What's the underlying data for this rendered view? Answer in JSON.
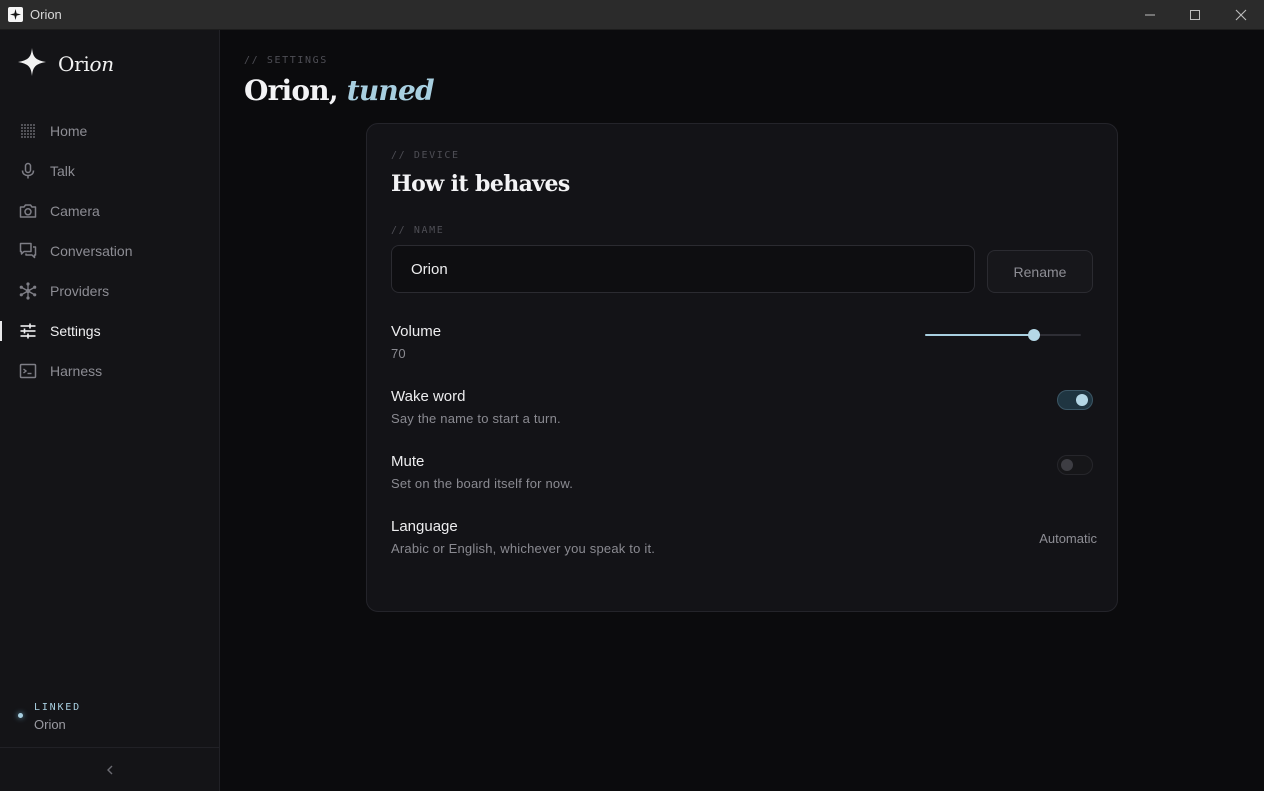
{
  "window": {
    "title": "Orion"
  },
  "brand": {
    "name_upright": "Ori",
    "name_italic": "on"
  },
  "nav": {
    "items": [
      {
        "label": "Home",
        "icon": "grid-dots-icon",
        "active": false
      },
      {
        "label": "Talk",
        "icon": "microphone-icon",
        "active": false
      },
      {
        "label": "Camera",
        "icon": "camera-icon",
        "active": false
      },
      {
        "label": "Conversation",
        "icon": "chat-bubbles-icon",
        "active": false
      },
      {
        "label": "Providers",
        "icon": "network-nodes-icon",
        "active": false
      },
      {
        "label": "Settings",
        "icon": "sliders-icon",
        "active": true
      },
      {
        "label": "Harness",
        "icon": "terminal-icon",
        "active": false
      }
    ]
  },
  "status": {
    "label": "LINKED",
    "device": "Orion"
  },
  "page": {
    "eyebrow": "// SETTINGS",
    "title_plain": "Orion,",
    "title_italic": "tuned"
  },
  "card": {
    "eyebrow": "// DEVICE",
    "title": "How it behaves",
    "name_eyebrow": "// NAME",
    "name_value": "Orion",
    "rename_label": "Rename",
    "volume": {
      "label": "Volume",
      "value": "70",
      "level": 0.7
    },
    "wake_word": {
      "label": "Wake word",
      "description": "Say the name to start a turn.",
      "enabled": true
    },
    "mute": {
      "label": "Mute",
      "description": "Set on the board itself for now.",
      "enabled": false
    },
    "language": {
      "label": "Language",
      "description": "Arabic or English, whichever you speak to it.",
      "value": "Automatic"
    }
  },
  "colors": {
    "accent": "#a8cfe0",
    "background": "#0b0b0d",
    "sidebar": "#141417",
    "card": "#131317"
  }
}
